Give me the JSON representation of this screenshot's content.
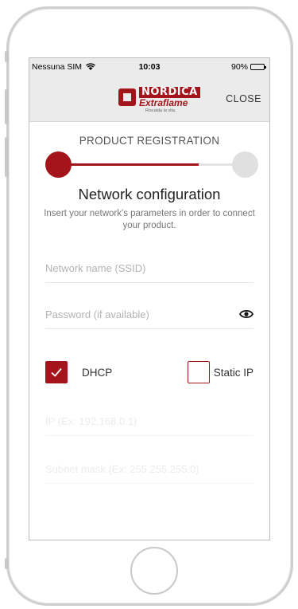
{
  "status_bar": {
    "carrier": "Nessuna SIM",
    "time": "10:03",
    "battery": "90%",
    "battery_level": 0.9
  },
  "header": {
    "logo": {
      "brand_top": "NORDICA",
      "brand_bottom": "Extraflame",
      "tagline": "Riscalda la vita."
    },
    "close_label": "CLOSE"
  },
  "page": {
    "registration_title": "PRODUCT REGISTRATION",
    "progress_fraction": 0.75,
    "section_title": "Network configuration",
    "description": "Insert your network's parameters in order to connect your product."
  },
  "form": {
    "ssid": {
      "value": "",
      "placeholder": "Network name (SSID)"
    },
    "password": {
      "value": "",
      "placeholder": "Password (if available)"
    },
    "options": [
      {
        "label": "DHCP",
        "checked": true
      },
      {
        "label": "Static IP",
        "checked": false
      }
    ],
    "ip": {
      "value": "",
      "placeholder": "IP (Ex: 192.168.0.1)"
    },
    "subnet": {
      "value": "",
      "placeholder": "Subnet mask (Ex: 255.255.255.0)"
    }
  },
  "colors": {
    "accent": "#a4151b",
    "navbar": "#ebebeb",
    "inactive_step": "#e0e0e0"
  },
  "icons": {
    "wifi": "wifi-icon",
    "battery": "battery-icon",
    "password_visibility": "eye-icon",
    "checkbox": "checkmark-icon"
  }
}
